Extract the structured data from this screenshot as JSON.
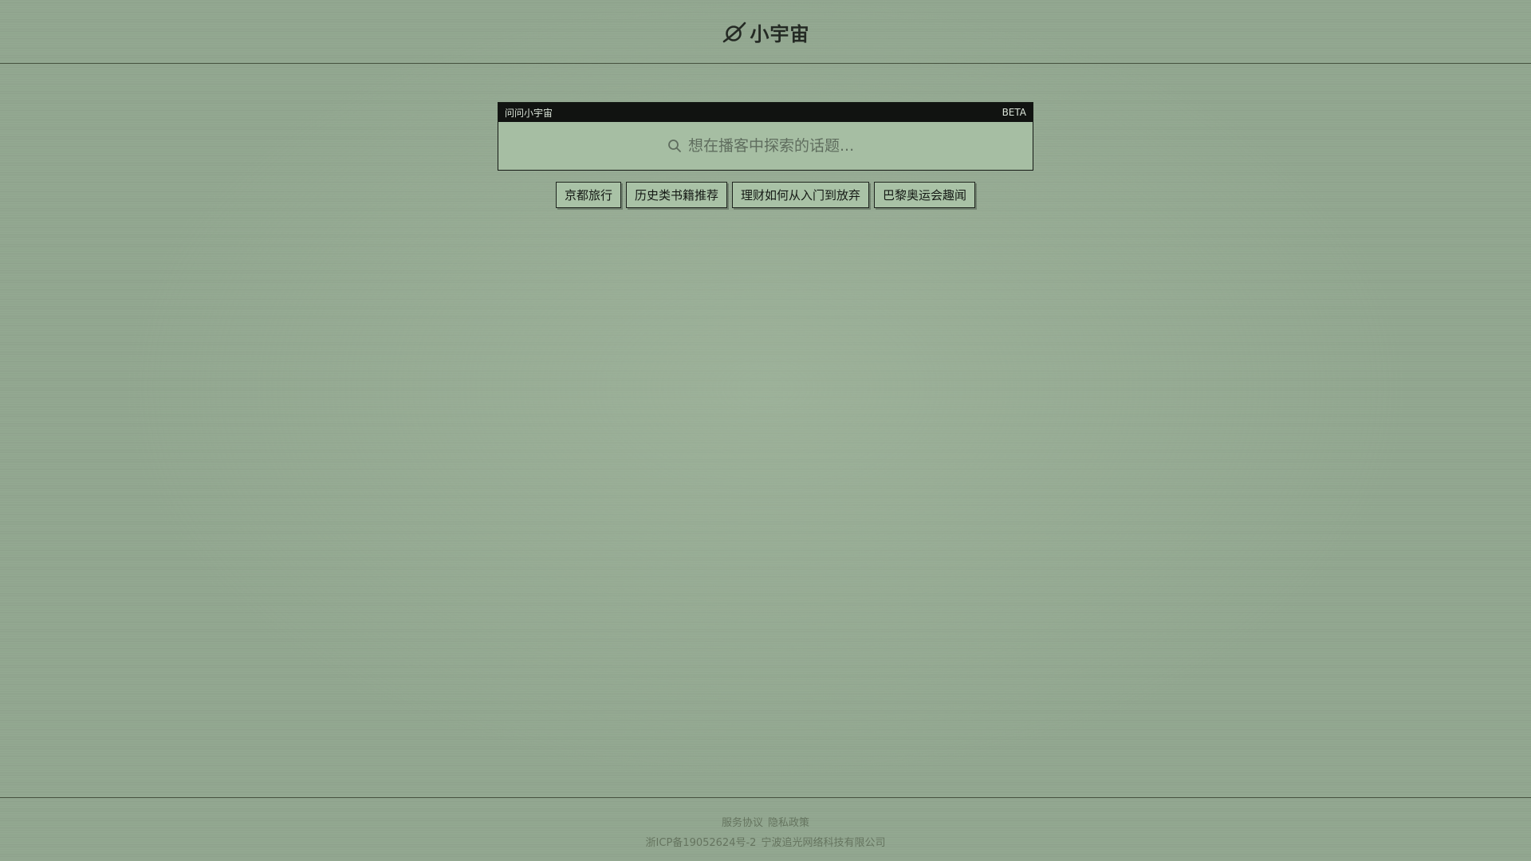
{
  "header": {
    "brand_name": "小宇宙",
    "logo_icon": "planet-icon"
  },
  "ask_panel": {
    "title": "问问小宇宙",
    "badge": "BETA",
    "search": {
      "placeholder": "想在播客中探索的话题...",
      "value": "",
      "icon": "search-icon"
    }
  },
  "suggestions": [
    {
      "label": "京都旅行"
    },
    {
      "label": "历史类书籍推荐"
    },
    {
      "label": "理财如何从入门到放弃"
    },
    {
      "label": "巴黎奥运会趣闻"
    }
  ],
  "footer": {
    "terms_label": "服务协议",
    "privacy_label": "隐私政策",
    "icp": "浙ICP备19052624号-2",
    "company": "宁波追光网络科技有限公司"
  },
  "colors": {
    "background": "#93a891",
    "panel": "#a6bea3",
    "panel_header": "#111311",
    "chip": "#a9c2a6"
  }
}
